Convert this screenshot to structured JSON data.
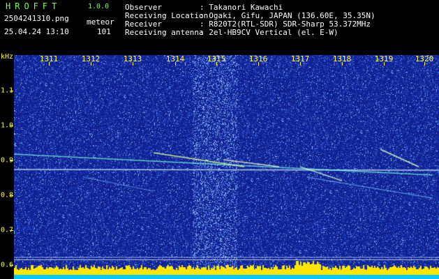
{
  "header": {
    "brand": "HROFFT",
    "version": "1.0.0",
    "filename": "2504241310.png",
    "datetime": "25.04.24 13:10",
    "mode_label": "meteor",
    "count": "101",
    "rows": [
      {
        "label": "Observer",
        "value": ": Takanori Kawachi"
      },
      {
        "label": "Receiving Location",
        "value": ": Ogaki, Gifu, JAPAN (136.60E, 35.35N)"
      },
      {
        "label": "Receiver",
        "value": ": R820T2(RTL-SDR) SDR-Sharp 53.372MHz"
      },
      {
        "label": "Receiving antenna",
        "value": ": 2el-HB9CV Vertical (el. E-W)"
      }
    ]
  },
  "axes": {
    "unit": "kHz",
    "x_ticks": [
      "1311",
      "1312",
      "1313",
      "1314",
      "1315",
      "1316",
      "1317",
      "1318",
      "1319",
      "1320"
    ],
    "y_ticks": [
      "1.1",
      "1.0",
      "0.9",
      "0.8",
      "0.7",
      "0.6"
    ]
  },
  "colors": {
    "background": "#14239a",
    "text": "#ffff40",
    "brand": "#7cff4a",
    "bottom_band": "#00c8ff"
  }
}
